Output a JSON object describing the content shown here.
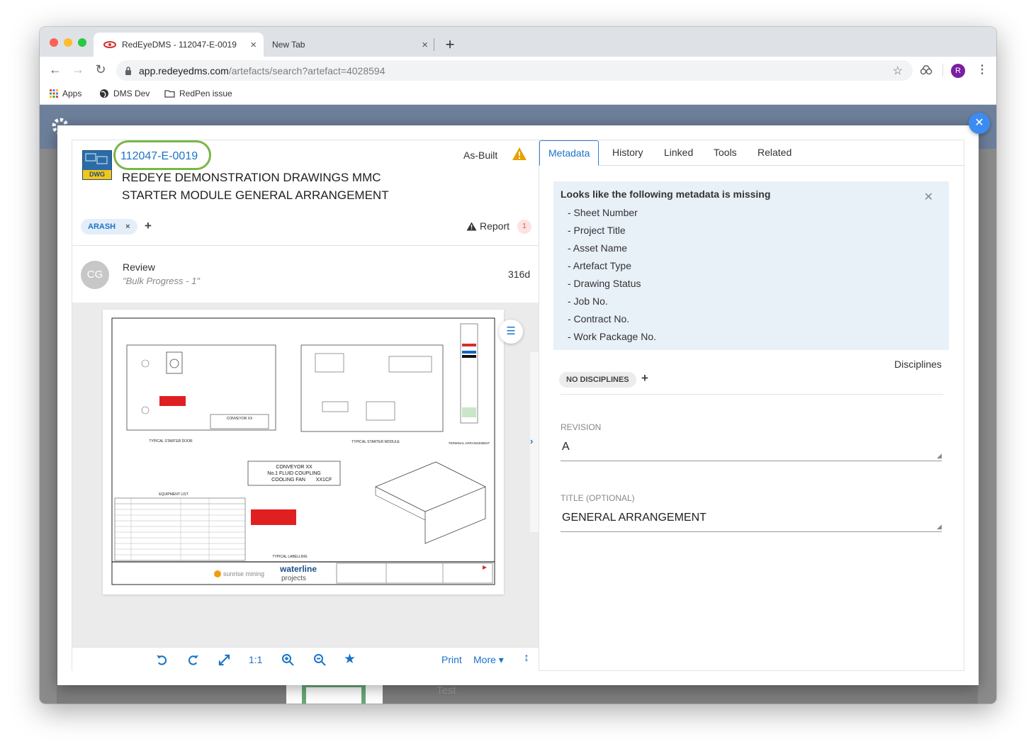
{
  "browser": {
    "tabs": [
      {
        "label": "RedEyeDMS - 112047-E-0019",
        "active": true
      },
      {
        "label": "New Tab",
        "active": false
      }
    ],
    "close_glyph": "×",
    "new_tab_glyph": "+",
    "url_host": "app.redeyedms.com",
    "url_path": "/artefacts/search?artefact=4028594",
    "profile_initial": "R",
    "bookmarks": [
      {
        "label": "Apps",
        "icon": "apps-grid-icon"
      },
      {
        "label": "DMS Dev",
        "icon": "globe-icon"
      },
      {
        "label": "RedPen issue",
        "icon": "folder-icon"
      }
    ]
  },
  "artefact": {
    "file_type": "DWG",
    "doc_id": "112047-E-0019",
    "title_line1": "REDEYE DEMONSTRATION DRAWINGS MMC",
    "title_line2": "STARTER MODULE GENERAL ARRANGEMENT",
    "status": "As-Built",
    "tag": "ARASH",
    "tag_remove": "×",
    "add": "+",
    "report_label": "Report",
    "report_count": "1"
  },
  "activity": {
    "initials": "CG",
    "action": "Review",
    "note": "\"Bulk Progress - 1\"",
    "age": "316d"
  },
  "drawing": {
    "callout1": "CONVEYOR XX",
    "callout2": "No.1 FLUID COUPLING",
    "callout3": "COOLING FAN",
    "callout4": "XX1CF",
    "label_door": "TYPICAL STARTER DOOR",
    "label_module": "TYPICAL STARTER MODULE",
    "label_terminal": "TERMINAL ARRANGEMENT",
    "label_labelling": "TYPICAL LABELLING",
    "equipment_list": "EQUIPMENT LIST",
    "logo1": "sunrise mining",
    "logo2": "waterline",
    "logo3": "projects"
  },
  "viewer_toolbar": {
    "ratio": "1:1",
    "print": "Print",
    "more": "More ▾"
  },
  "right_tabs": [
    "Metadata",
    "History",
    "Linked",
    "Tools",
    "Related"
  ],
  "metadata": {
    "missing_title": "Looks like the following metadata is missing",
    "missing_items": [
      "- Sheet Number",
      "- Project Title",
      "- Asset Name",
      "- Artefact Type",
      "- Drawing Status",
      "- Job No.",
      "- Contract No.",
      "- Work Package No."
    ],
    "disciplines_label": "Disciplines",
    "no_disciplines": "NO DISCIPLINES",
    "revision_label": "REVISION",
    "revision_value": "A",
    "title_label": "TITLE (OPTIONAL)",
    "title_value": "GENERAL ARRANGEMENT"
  },
  "background": {
    "behind_text": "Test"
  },
  "colors": {
    "accent": "#1a73c9",
    "highlight_ring": "#7ab648",
    "warning": "#e6a100"
  }
}
